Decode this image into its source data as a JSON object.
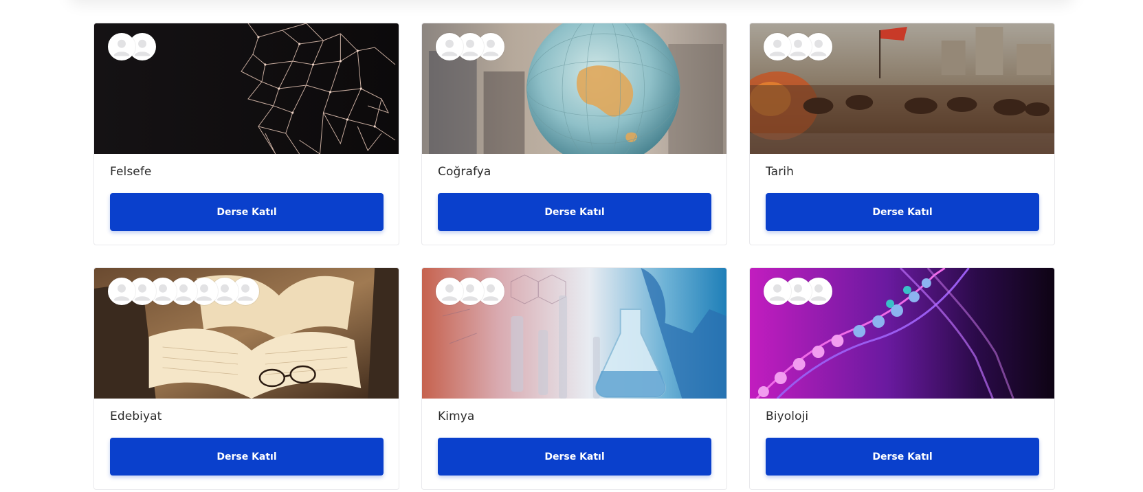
{
  "button_label": "Derse Katıl",
  "colors": {
    "accent": "#0a40cc",
    "card_border": "#e9e9ec",
    "title_text": "#2b2b2b"
  },
  "courses": [
    {
      "title": "Felsefe",
      "avatar_count": 2,
      "image": "network-map-image"
    },
    {
      "title": "Coğrafya",
      "avatar_count": 3,
      "image": "globe-image"
    },
    {
      "title": "Tarih",
      "avatar_count": 3,
      "image": "battle-painting-image"
    },
    {
      "title": "Edebiyat",
      "avatar_count": 7,
      "image": "open-books-image"
    },
    {
      "title": "Kimya",
      "avatar_count": 3,
      "image": "lab-flask-image"
    },
    {
      "title": "Biyoloji",
      "avatar_count": 3,
      "image": "dna-helix-image"
    }
  ]
}
